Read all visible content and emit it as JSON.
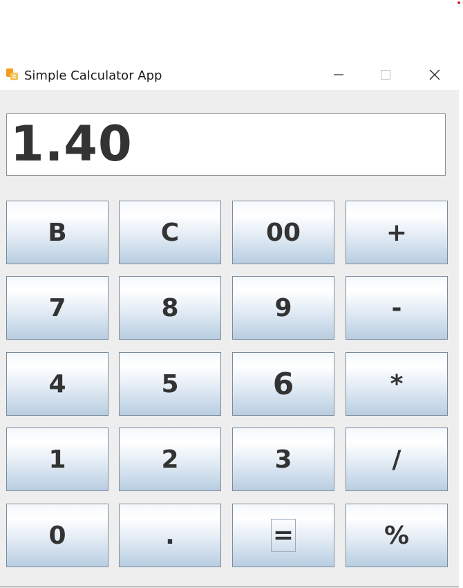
{
  "window": {
    "title": "Simple Calculator App",
    "icon": "calculator-app-icon",
    "controls": {
      "minimize": "minimize-icon",
      "maximize": "maximize-icon",
      "close": "close-icon"
    }
  },
  "display": {
    "value": "1.40"
  },
  "keypad": {
    "row0": [
      "B",
      "C",
      "00",
      "+"
    ],
    "row1": [
      "7",
      "8",
      "9",
      "-"
    ],
    "row2": [
      "4",
      "5",
      "6",
      "*"
    ],
    "row3": [
      "1",
      "2",
      "3",
      "/"
    ],
    "row4": [
      "0",
      ".",
      "=",
      "%"
    ]
  },
  "colors": {
    "window_bg": "#eeeeee",
    "key_text": "#333333",
    "key_gradient_bottom": "#b8cde1",
    "accent_dot": "#e02020"
  }
}
